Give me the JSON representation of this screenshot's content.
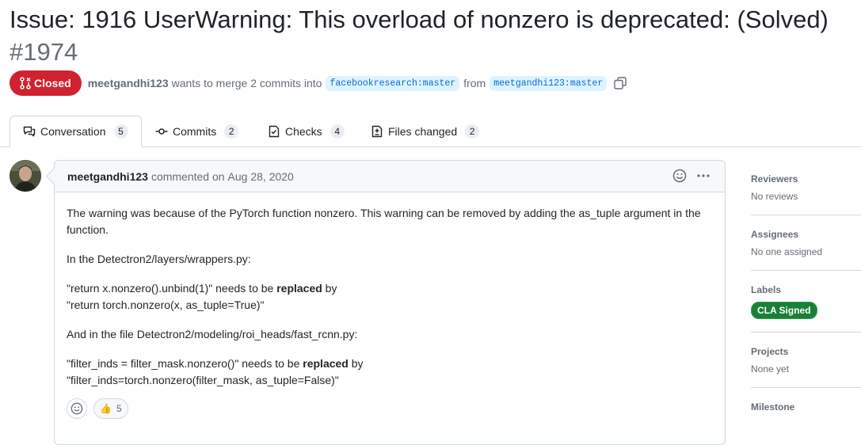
{
  "title": {
    "text": "Issue: 1916 UserWarning: This overload of nonzero is deprecated: (Solved)",
    "number": "#1974"
  },
  "meta": {
    "state": "Closed",
    "author": "meetgandhi123",
    "action": "wants to merge 2 commits into",
    "base_branch": "facebookresearch:master",
    "from_word": "from",
    "head_branch": "meetgandhi123:master",
    "state_color": "#cf222e"
  },
  "tabs": [
    {
      "label": "Conversation",
      "count": "5",
      "icon": "comment-discussion-icon"
    },
    {
      "label": "Commits",
      "count": "2",
      "icon": "git-commit-icon"
    },
    {
      "label": "Checks",
      "count": "4",
      "icon": "checklist-icon"
    },
    {
      "label": "Files changed",
      "count": "2",
      "icon": "file-diff-icon"
    }
  ],
  "comment": {
    "author": "meetgandhi123",
    "action": "commented on",
    "date": "Aug 28, 2020",
    "body": {
      "p1": "The warning was because of the PyTorch function nonzero. This warning can be removed by adding the as_tuple argument in the function.",
      "p2": "In the Detectron2/layers/wrappers.py:",
      "p3a_pre": "\"return x.nonzero().unbind(1)\" needs to be ",
      "p3a_bold": "replaced",
      "p3a_post": " by",
      "p3b": "\"return torch.nonzero(x, as_tuple=True)\"",
      "p4": "And in the file Detectron2/modeling/roi_heads/fast_rcnn.py:",
      "p5a_pre": "\"filter_inds = filter_mask.nonzero()\" needs to be ",
      "p5a_bold": "replaced",
      "p5a_post": " by",
      "p5b": "\"filter_inds=torch.nonzero(filter_mask, as_tuple=False)\""
    },
    "reactions": {
      "thumbs_up": "👍",
      "count": "5"
    }
  },
  "sidebar": {
    "reviewers": {
      "heading": "Reviewers",
      "value": "No reviews"
    },
    "assignees": {
      "heading": "Assignees",
      "value": "No one assigned"
    },
    "labels": {
      "heading": "Labels",
      "label": "CLA Signed",
      "label_color": "#1a7f37"
    },
    "projects": {
      "heading": "Projects",
      "value": "None yet"
    },
    "milestone": {
      "heading": "Milestone"
    }
  }
}
